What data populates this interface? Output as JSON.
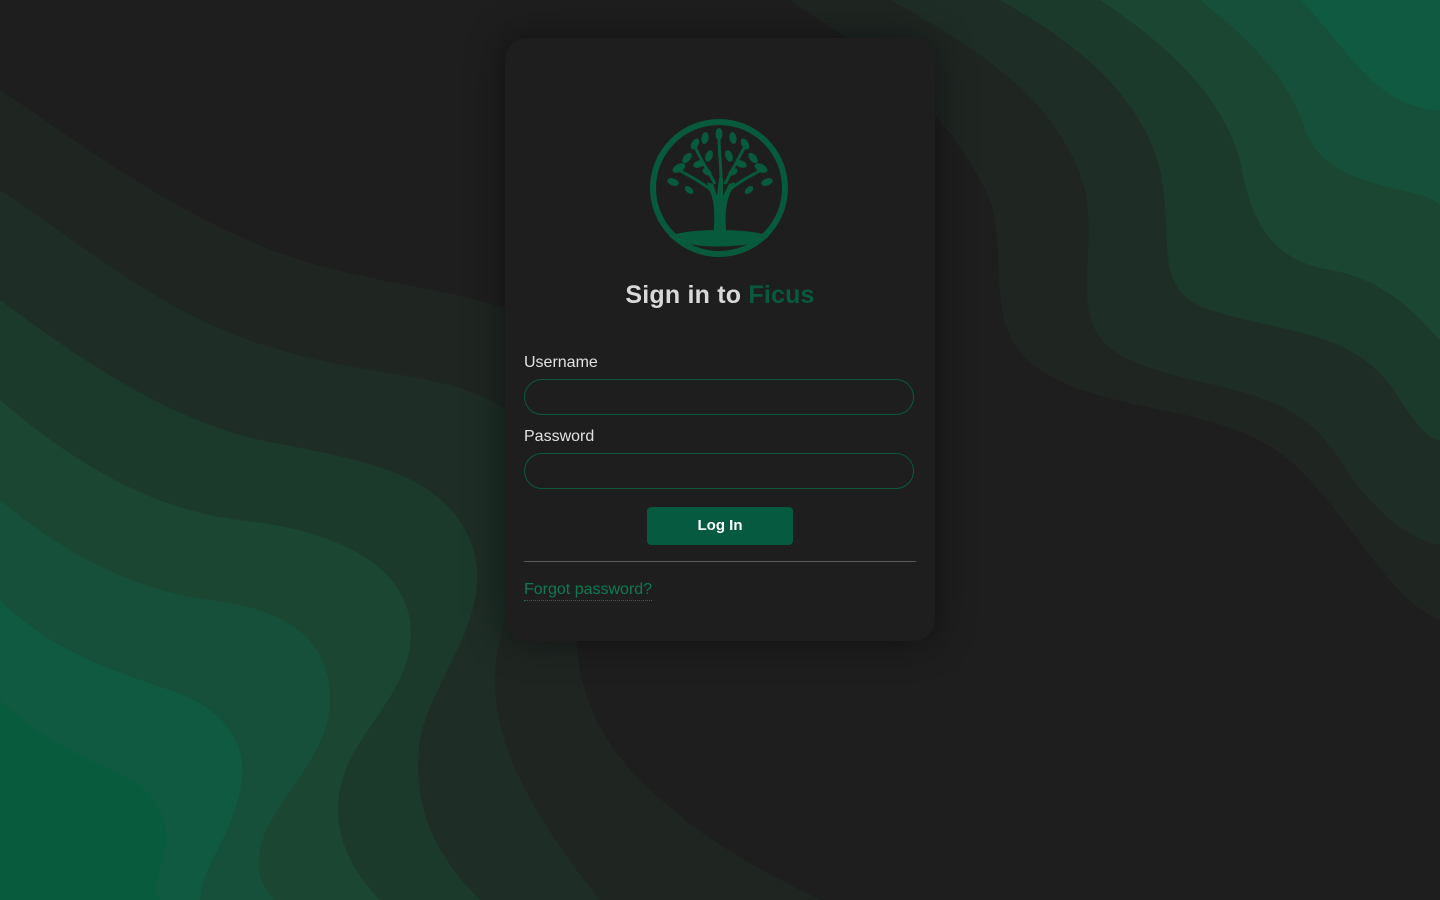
{
  "colors": {
    "background": "#1e1e1e",
    "brand_green": "#085a3c",
    "button_green": "#065a40",
    "link_green": "#0e7a52",
    "input_border": "#0b5a3a"
  },
  "logo": {
    "icon": "tree-of-life-icon"
  },
  "heading": {
    "prefix": "Sign in to ",
    "brand": "Ficus"
  },
  "form": {
    "username_label": "Username",
    "username_value": "",
    "password_label": "Password",
    "password_value": "",
    "login_label": "Log In"
  },
  "footer": {
    "forgot_password": "Forgot password?"
  }
}
